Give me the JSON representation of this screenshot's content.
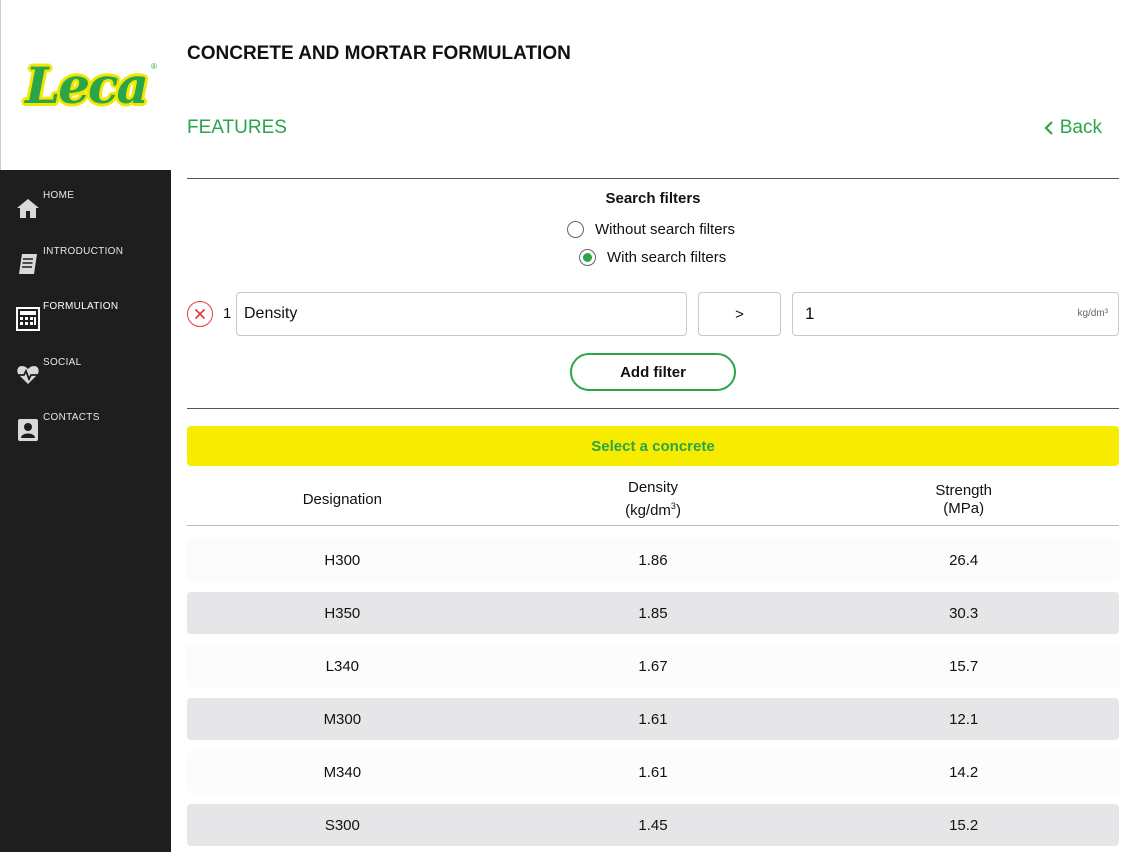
{
  "app": {
    "logo_text": "Leca",
    "logo_mark": "®",
    "title": "CONCRETE AND MORTAR FORMULATION",
    "section": "FEATURES",
    "back_label": "Back"
  },
  "sidebar": {
    "items": [
      {
        "label": "HOME",
        "icon": "home-icon"
      },
      {
        "label": "INTRODUCTION",
        "icon": "book-icon"
      },
      {
        "label": "FORMULATION",
        "icon": "calculator-icon",
        "active": true
      },
      {
        "label": "SOCIAL",
        "icon": "heart-pulse-icon"
      },
      {
        "label": "CONTACTS",
        "icon": "contact-card-icon"
      }
    ]
  },
  "filters": {
    "heading": "Search filters",
    "options": [
      {
        "label": "Without search filters",
        "selected": false
      },
      {
        "label": "With search filters",
        "selected": true
      }
    ],
    "rows": [
      {
        "index": "1",
        "field": "Density",
        "operator": ">",
        "value": "1",
        "unit": "kg/dm³"
      }
    ],
    "add_label": "Add filter"
  },
  "table": {
    "select_label": "Select a concrete",
    "headers": {
      "designation": "Designation",
      "density": "Density",
      "density_unit": "(kg/dm",
      "density_sup": "3",
      "density_close": ")",
      "strength": "Strength",
      "strength_unit": "(MPa)"
    },
    "rows": [
      {
        "designation": "H300",
        "density": "1.86",
        "strength": "26.4"
      },
      {
        "designation": "H350",
        "density": "1.85",
        "strength": "30.3"
      },
      {
        "designation": "L340",
        "density": "1.67",
        "strength": "15.7"
      },
      {
        "designation": "M300",
        "density": "1.61",
        "strength": "12.1"
      },
      {
        "designation": "M340",
        "density": "1.61",
        "strength": "14.2"
      },
      {
        "designation": "S300",
        "density": "1.45",
        "strength": "15.2"
      }
    ]
  },
  "colors": {
    "accent": "#2aa54a",
    "brand_yellow": "#f7ec00",
    "sidebar_bg": "#1e1e1e",
    "remove_red": "#e23b3b"
  }
}
